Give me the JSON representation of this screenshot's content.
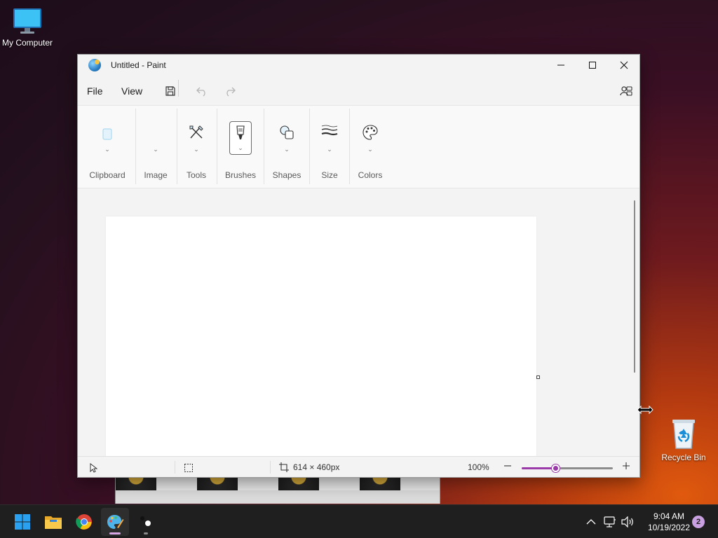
{
  "desktop": {
    "my_computer_label": "My Computer",
    "recycle_bin_label": "Recycle Bin"
  },
  "window": {
    "title": "Untitled - Paint"
  },
  "menu": {
    "file": "File",
    "view": "View"
  },
  "ribbon": {
    "groups": [
      {
        "label": "Clipboard",
        "icon": "clipboard-icon"
      },
      {
        "label": "Image",
        "icon": "image-icon"
      },
      {
        "label": "Tools",
        "icon": "tools-icon"
      },
      {
        "label": "Brushes",
        "icon": "brush-icon"
      },
      {
        "label": "Shapes",
        "icon": "shapes-icon"
      },
      {
        "label": "Size",
        "icon": "size-icon"
      },
      {
        "label": "Colors",
        "icon": "palette-icon"
      }
    ]
  },
  "status": {
    "canvas_size": "614 × 460px",
    "zoom": "100%",
    "zoom_level_fraction": 0.38
  },
  "clock": {
    "time": "9:04 AM",
    "date": "10/19/2022"
  },
  "notifications": {
    "count": "2"
  },
  "colors": {
    "accent": "#9a3aa8",
    "taskbar": "#1f1f1f"
  }
}
